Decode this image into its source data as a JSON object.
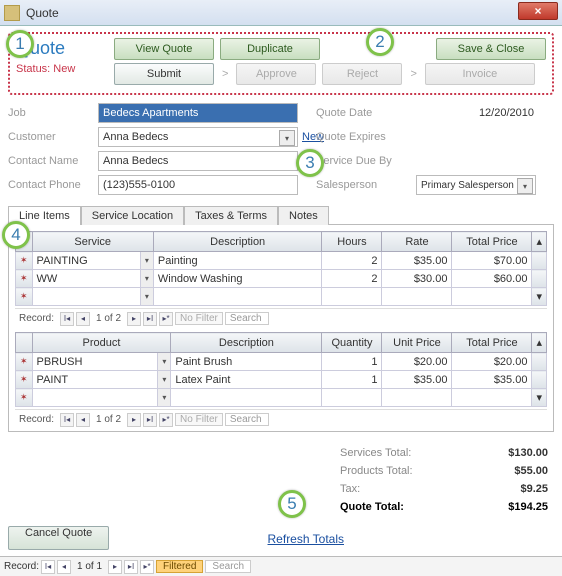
{
  "window": {
    "title": "Quote",
    "close_glyph": "×"
  },
  "header": {
    "quote_word": "Quote",
    "status_label": "Status: New",
    "buttons": {
      "view": "View Quote",
      "duplicate": "Duplicate",
      "save_close": "Save & Close",
      "submit": "Submit",
      "approve": "Approve",
      "reject": "Reject",
      "invoice": "Invoice"
    }
  },
  "fields": {
    "job_label": "Job",
    "job_value": "Bedecs Apartments",
    "customer_label": "Customer",
    "customer_value": "Anna Bedecs",
    "new_link": "New",
    "contact_name_label": "Contact Name",
    "contact_name_value": "Anna Bedecs",
    "contact_phone_label": "Contact Phone",
    "contact_phone_value": "(123)555-0100",
    "quote_date_label": "Quote Date",
    "quote_date_value": "12/20/2010",
    "quote_expires_label": "Quote Expires",
    "quote_expires_value": "",
    "service_due_label": "Service Due By",
    "service_due_value": "",
    "salesperson_label": "Salesperson",
    "salesperson_value": "Primary Salesperson"
  },
  "tabs": {
    "t1": "Line Items",
    "t2": "Service Location",
    "t3": "Taxes & Terms",
    "t4": "Notes"
  },
  "services_grid": {
    "headers": {
      "c1": "Service",
      "c2": "Description",
      "c3": "Hours",
      "c4": "Rate",
      "c5": "Total Price"
    },
    "rows": [
      {
        "code": "PAINTING",
        "desc": "Painting",
        "hours": "2",
        "rate": "$35.00",
        "total": "$70.00"
      },
      {
        "code": "WW",
        "desc": "Window Washing",
        "hours": "2",
        "rate": "$30.00",
        "total": "$60.00"
      }
    ],
    "nav": {
      "label": "Record:",
      "pos": "1 of 2",
      "filter": "No Filter",
      "search": "Search"
    }
  },
  "products_grid": {
    "headers": {
      "c1": "Product",
      "c2": "Description",
      "c3": "Quantity",
      "c4": "Unit Price",
      "c5": "Total Price"
    },
    "rows": [
      {
        "code": "PBRUSH",
        "desc": "Paint Brush",
        "qty": "1",
        "price": "$20.00",
        "total": "$20.00"
      },
      {
        "code": "PAINT",
        "desc": "Latex Paint",
        "qty": "1",
        "price": "$35.00",
        "total": "$35.00"
      }
    ],
    "nav": {
      "label": "Record:",
      "pos": "1 of 2",
      "filter": "No Filter",
      "search": "Search"
    }
  },
  "totals": {
    "services_label": "Services Total:",
    "services_value": "$130.00",
    "products_label": "Products Total:",
    "products_value": "$55.00",
    "tax_label": "Tax:",
    "tax_value": "$9.25",
    "quote_label": "Quote Total:",
    "quote_value": "$194.25",
    "refresh": "Refresh Totals"
  },
  "footer": {
    "cancel": "Cancel Quote",
    "nav": {
      "label": "Record:",
      "pos": "1 of 1",
      "filter": "Filtered",
      "search": "Search"
    }
  },
  "markers": {
    "m1": "1",
    "m2": "2",
    "m3": "3",
    "m4": "4",
    "m5": "5"
  }
}
